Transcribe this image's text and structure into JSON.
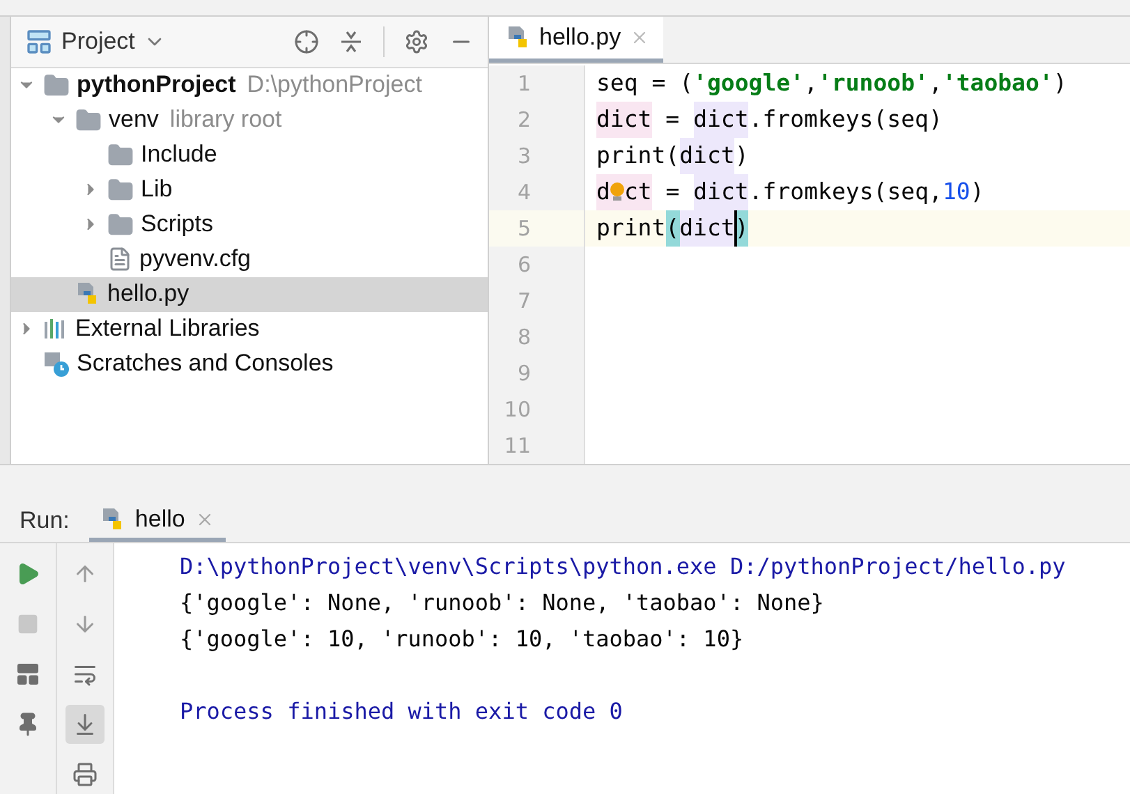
{
  "project_panel": {
    "title": "Project",
    "tree": [
      {
        "name": "pythonProject",
        "hint": "D:\\pythonProject",
        "kind": "folder",
        "expanded": true,
        "bold": true,
        "selected": false,
        "children": [
          {
            "name": "venv",
            "hint": "library root",
            "kind": "folder",
            "expanded": true,
            "bold": false,
            "selected": false,
            "children": [
              {
                "name": "Include",
                "kind": "folder",
                "bold": false,
                "selected": false
              },
              {
                "name": "Lib",
                "kind": "folder",
                "expanded": false,
                "bold": false,
                "selected": false
              },
              {
                "name": "Scripts",
                "kind": "folder",
                "expanded": false,
                "bold": false,
                "selected": false
              },
              {
                "name": "pyvenv.cfg",
                "kind": "text-file",
                "bold": false,
                "selected": false
              }
            ]
          },
          {
            "name": "hello.py",
            "kind": "python-file",
            "bold": false,
            "selected": true
          }
        ]
      },
      {
        "name": "External Libraries",
        "kind": "libraries",
        "expanded": false,
        "bold": false,
        "selected": false
      },
      {
        "name": "Scratches and Consoles",
        "kind": "scratches",
        "bold": false,
        "selected": false
      }
    ]
  },
  "editor": {
    "tabs": [
      {
        "label": "hello.py",
        "selected": true
      }
    ],
    "lines": [
      {
        "number": "1",
        "current": false,
        "bulb": false,
        "tokens": [
          {
            "text": "seq = (",
            "kind": "plain"
          },
          {
            "text": "'google'",
            "kind": "string"
          },
          {
            "text": ",",
            "kind": "plain"
          },
          {
            "text": "'runoob'",
            "kind": "string"
          },
          {
            "text": ",",
            "kind": "plain"
          },
          {
            "text": "'taobao'",
            "kind": "string"
          },
          {
            "text": ")",
            "kind": "plain"
          }
        ]
      },
      {
        "number": "2",
        "current": false,
        "bulb": false,
        "tokens": [
          {
            "text": "dict",
            "kind": "var-write"
          },
          {
            "text": " = ",
            "kind": "plain"
          },
          {
            "text": "dict",
            "kind": "var-read"
          },
          {
            "text": ".fromkeys(seq)",
            "kind": "plain"
          }
        ]
      },
      {
        "number": "3",
        "current": false,
        "bulb": false,
        "tokens": [
          {
            "text": "print(",
            "kind": "plain"
          },
          {
            "text": "dict",
            "kind": "var-read"
          },
          {
            "text": ")",
            "kind": "plain"
          }
        ]
      },
      {
        "number": "4",
        "current": false,
        "bulb": true,
        "tokens": [
          {
            "text": "d",
            "kind": "var-write"
          },
          {
            "text": "ct",
            "kind": "var-write"
          },
          {
            "text": " = ",
            "kind": "plain"
          },
          {
            "text": "dict",
            "kind": "var-read"
          },
          {
            "text": ".fromkeys(seq,",
            "kind": "plain"
          },
          {
            "text": "10",
            "kind": "number"
          },
          {
            "text": ")",
            "kind": "plain"
          }
        ]
      },
      {
        "number": "5",
        "current": true,
        "bulb": false,
        "tokens": [
          {
            "text": "print",
            "kind": "plain"
          },
          {
            "text": "(",
            "kind": "brace-match"
          },
          {
            "text": "dict",
            "kind": "var-read"
          },
          {
            "text": ")",
            "kind": "brace-match-caret"
          }
        ]
      },
      {
        "number": "6",
        "current": false
      },
      {
        "number": "7",
        "current": false
      },
      {
        "number": "8",
        "current": false
      },
      {
        "number": "9",
        "current": false
      },
      {
        "number": "10",
        "current": false
      },
      {
        "number": "11",
        "current": false
      }
    ]
  },
  "run_panel": {
    "label": "Run:",
    "tabs": [
      {
        "label": "hello",
        "selected": true
      }
    ],
    "console": [
      {
        "kind": "command",
        "text": "D:\\pythonProject\\venv\\Scripts\\python.exe D:/pythonProject/hello.py"
      },
      {
        "kind": "output",
        "text": "{'google': None, 'runoob': None, 'taobao': None}"
      },
      {
        "kind": "output",
        "text": "{'google': 10, 'runoob': 10, 'taobao': 10}"
      },
      {
        "kind": "status",
        "text": "Process finished with exit code 0"
      }
    ]
  }
}
